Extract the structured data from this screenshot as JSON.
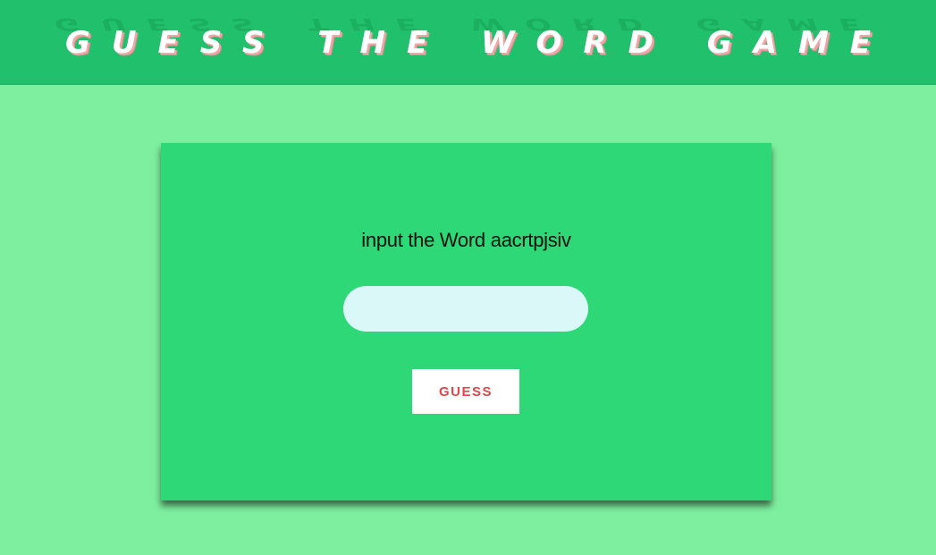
{
  "header": {
    "title": "GUESS THE WORD GAME"
  },
  "game": {
    "prompt_label": "input the Word",
    "scrambled_word": "aacrtpjsiv",
    "input_value": "",
    "guess_button_label": "GUESS"
  },
  "colors": {
    "page_background": "#7def9e",
    "header_background": "#20c06c",
    "card_background": "#2ed876",
    "input_background": "#dbf8f8",
    "button_text": "#e0474a"
  }
}
